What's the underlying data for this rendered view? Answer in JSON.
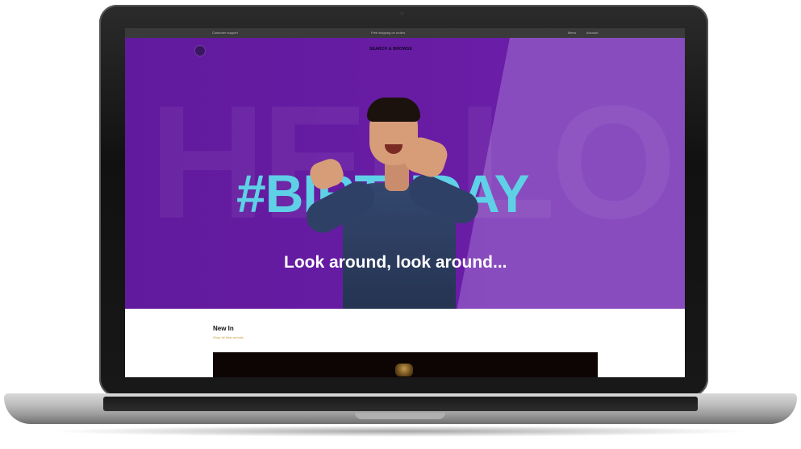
{
  "topbar": {
    "left_text": "Customer support",
    "center_text": "Free shipping on orders",
    "right_items": [
      "Menu",
      "Account"
    ]
  },
  "header": {
    "logo_text": "",
    "center_link": "SEARCH & BROWSE"
  },
  "hero": {
    "background_word": "HELLO",
    "headline": "#BIRTHDAY",
    "subheadline": "Look around, look around..."
  },
  "section": {
    "title": "New In",
    "link_text": "Shop all New arrivals"
  },
  "colors": {
    "hero_purple": "#6a1da6",
    "headline_cyan": "#5fd1e6",
    "accent_gold": "#c79a35"
  }
}
